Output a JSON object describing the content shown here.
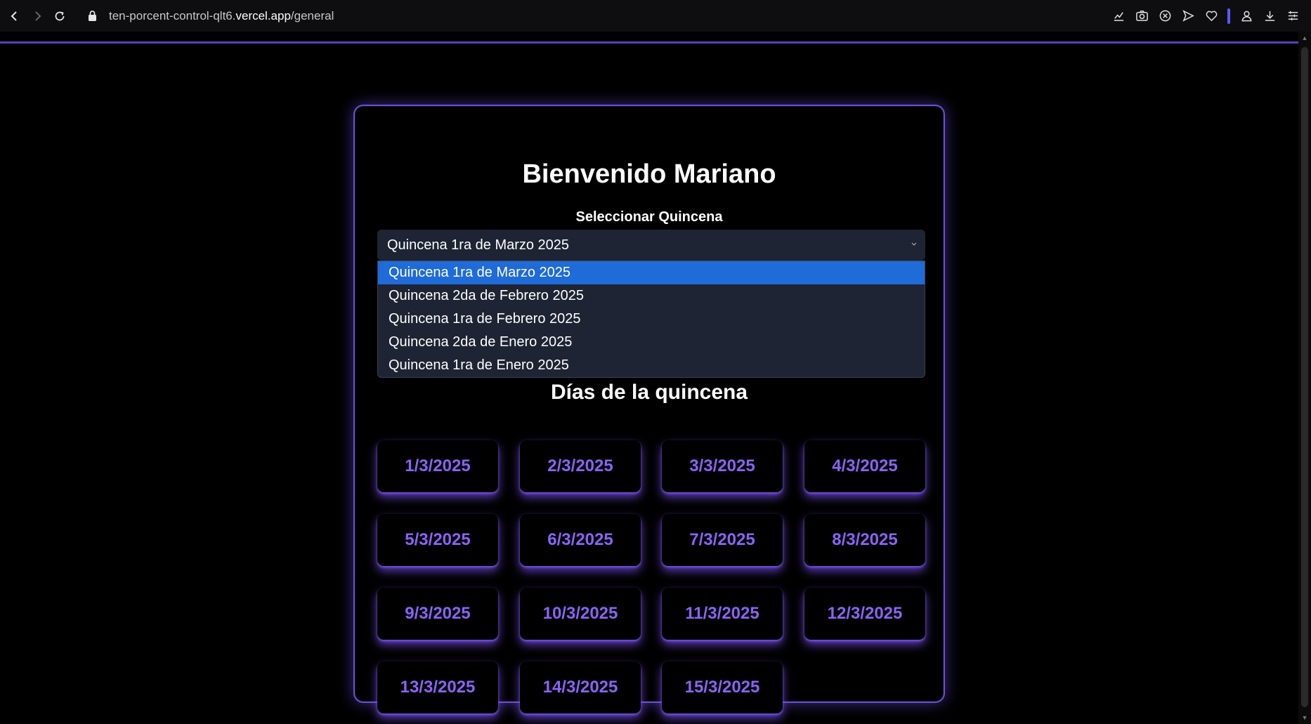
{
  "browser": {
    "url_prefix": "ten-porcent-control-qlt6.",
    "url_domain": "vercel.app",
    "url_path": "/general"
  },
  "page": {
    "title": "Bienvenido Mariano",
    "select_label": "Seleccionar Quincena",
    "selected_value": "Quincena 1ra de Marzo 2025",
    "options": [
      "Quincena 1ra de Marzo 2025",
      "Quincena 2da de Febrero 2025",
      "Quincena 1ra de Febrero 2025",
      "Quincena 2da de Enero 2025",
      "Quincena 1ra de Enero 2025"
    ],
    "days_title": "Días de la quincena",
    "days": [
      "1/3/2025",
      "2/3/2025",
      "3/3/2025",
      "4/3/2025",
      "5/3/2025",
      "6/3/2025",
      "7/3/2025",
      "8/3/2025",
      "9/3/2025",
      "10/3/2025",
      "11/3/2025",
      "12/3/2025",
      "13/3/2025",
      "14/3/2025",
      "15/3/2025"
    ]
  },
  "colors": {
    "accent": "#8b63f5",
    "border": "#6a4fd6",
    "select_bg": "#1e2433",
    "selected_option": "#1f6bd8"
  }
}
